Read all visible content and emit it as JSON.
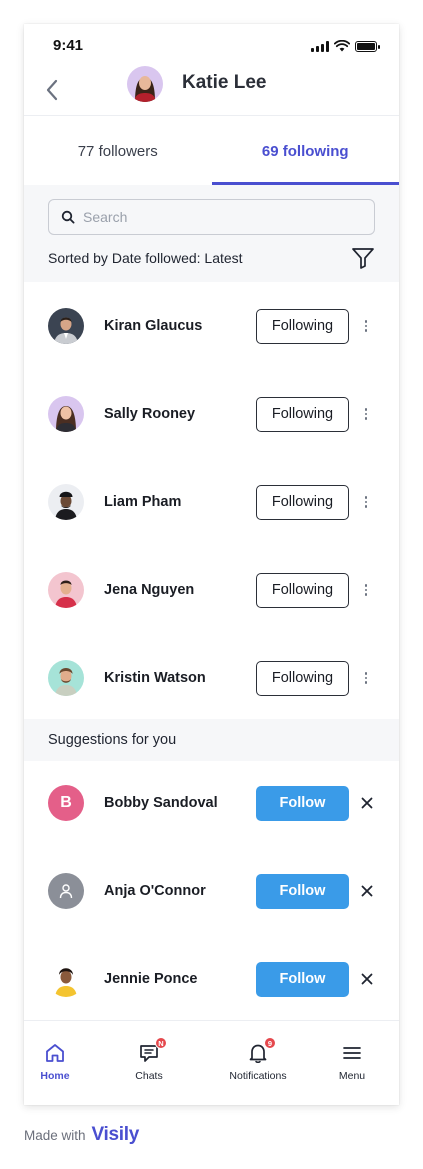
{
  "status_bar": {
    "time": "9:41"
  },
  "header": {
    "back_icon": "chevron-left-icon",
    "title": "Katie Lee"
  },
  "tabs": [
    {
      "label": "77 followers",
      "active": false
    },
    {
      "label": "69 following",
      "active": true
    }
  ],
  "search": {
    "placeholder": "Search",
    "value": ""
  },
  "sort": {
    "prefix": "Sorted by",
    "value": "Date followed: Latest"
  },
  "following": [
    {
      "name": "Kiran Glaucus",
      "button": "Following",
      "avatar_bg": "#3b4452"
    },
    {
      "name": "Sally Rooney",
      "button": "Following",
      "avatar_bg": "#d9c6ef"
    },
    {
      "name": "Liam Pham",
      "button": "Following",
      "avatar_bg": "#eceef2"
    },
    {
      "name": "Jena Nguyen",
      "button": "Following",
      "avatar_bg": "#f3c5cf"
    },
    {
      "name": "Kristin Watson",
      "button": "Following",
      "avatar_bg": "#a6e3d8"
    }
  ],
  "suggestions": {
    "title": "Suggestions for you",
    "items": [
      {
        "name": "Bobby Sandoval",
        "button": "Follow",
        "initial": "B",
        "avatar_bg": "#e45f89"
      },
      {
        "name": "Anja O'Connor",
        "button": "Follow",
        "initial": "",
        "avatar_bg": "#8b8f98"
      },
      {
        "name": "Jennie Ponce",
        "button": "Follow",
        "initial": "",
        "avatar_bg": "#ffffff"
      }
    ]
  },
  "bottom_nav": [
    {
      "label": "Home",
      "icon": "home-icon",
      "active": true,
      "badge": ""
    },
    {
      "label": "Chats",
      "icon": "chat-icon",
      "active": false,
      "badge": "N"
    },
    {
      "label": "Notifications",
      "icon": "bell-icon",
      "active": false,
      "badge": "9"
    },
    {
      "label": "Menu",
      "icon": "menu-icon",
      "active": false,
      "badge": ""
    }
  ],
  "footer": {
    "made_with": "Made with",
    "brand": "Visily"
  },
  "colors": {
    "accent": "#4a4fd0",
    "follow_button": "#3a9be8",
    "badge": "#e5484d"
  }
}
